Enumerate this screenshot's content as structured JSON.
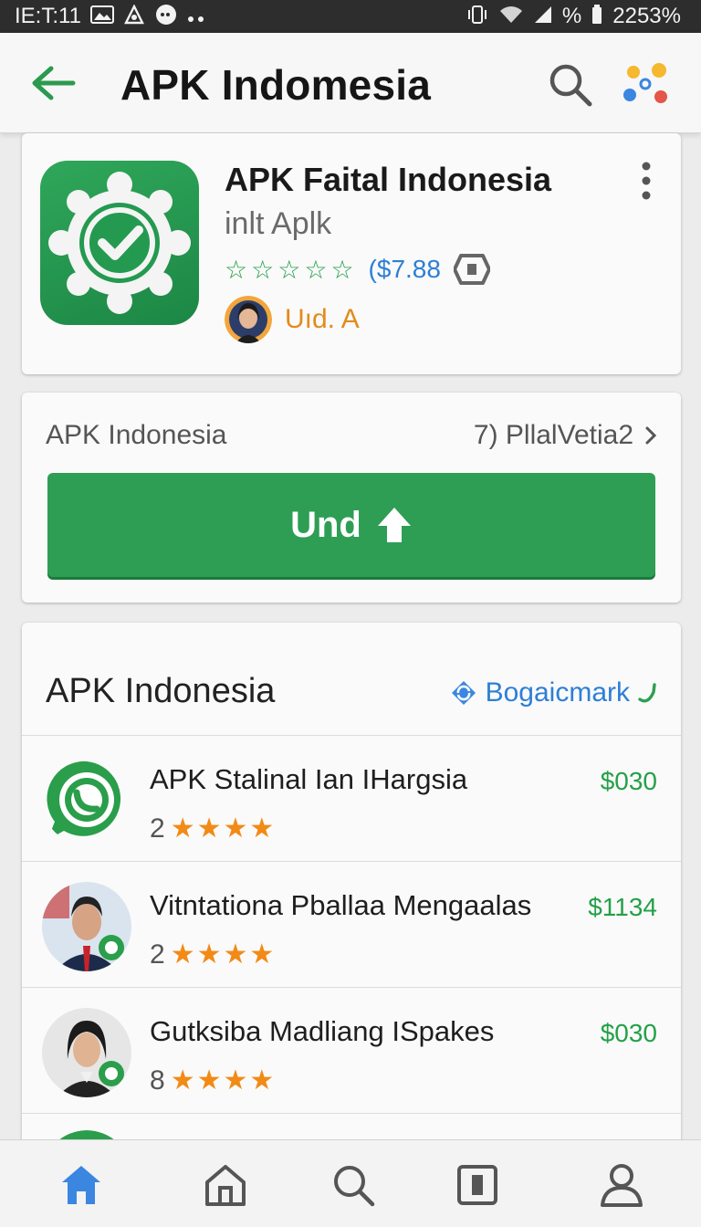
{
  "status_bar": {
    "time": "IE:T:11",
    "battery": "2253%",
    "percent_glyph": "%"
  },
  "app_bar": {
    "title": "APK Indomesia"
  },
  "app_card": {
    "name": "APK Faital Indonesia",
    "developer": "inlt Aplk",
    "rating_stars": 5,
    "price": "($7.88",
    "author": "Uıd. A"
  },
  "install_card": {
    "label": "APK Indonesia",
    "link_text": "7) PllalVetia2",
    "install_label": "Und"
  },
  "list_section": {
    "title": "APK Indonesia",
    "link_text": "Bogaicmark",
    "items": [
      {
        "title": "APK Stalinal Ian IHargsia",
        "rating": "2",
        "stars": "★★★★",
        "price": "$030"
      },
      {
        "title": "Vitntationa Pballaa Mengaalas",
        "rating": "2",
        "stars": "★★★★",
        "price": "$1134"
      },
      {
        "title": "Gutksiba Madliang ISpakes",
        "rating": "8",
        "stars": "★★★★",
        "price": "$030"
      }
    ]
  },
  "icons": {
    "back": "arrow-left-icon",
    "search": "search-icon",
    "assistant": "assistant-dots-icon",
    "more": "more-vert-icon",
    "home": "home-icon",
    "apps": "store-home-icon",
    "nav_search": "search-icon",
    "library": "library-icon",
    "profile": "profile-icon"
  },
  "colors": {
    "primary_green": "#2e9e55",
    "accent_blue": "#2d7fd6",
    "star_orange": "#f28a16",
    "nav_active": "#3b86e0"
  }
}
